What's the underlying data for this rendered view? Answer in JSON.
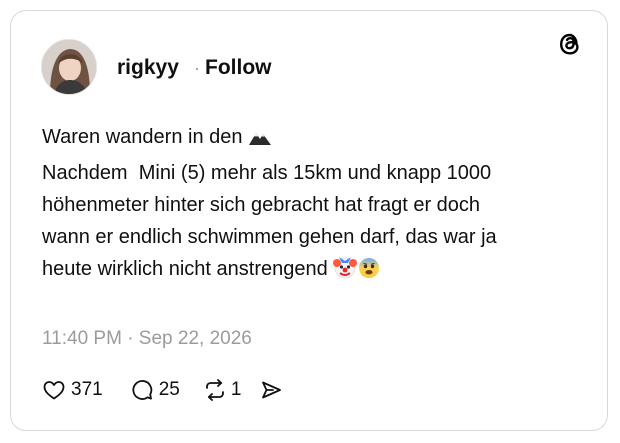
{
  "post": {
    "username": "rigkyy",
    "separator": "·",
    "follow_label": "Follow",
    "text_lines": [
      "Waren wandern in den",
      "",
      "Nachdem  Mini (5) mehr als 15km und knapp 1000",
      "höhenmeter hinter sich gebracht hat fragt er doch",
      "wann er endlich schwimmen gehen darf, das war ja",
      "heute wirklich nicht anstrengend"
    ],
    "emojis": [
      "mountain-emoji",
      "clown-face-emoji",
      "fearful-face-emoji"
    ],
    "timestamp": "11:40 PM · Sep 22, 2026"
  },
  "actions": {
    "likes": "371",
    "replies": "25",
    "reposts": "1"
  },
  "icons": {
    "logo": "threads-logo-icon",
    "like": "heart-icon",
    "reply": "comment-bubble-icon",
    "repost": "repost-icon",
    "share": "send-icon"
  },
  "colors": {
    "text": "#101010",
    "muted": "#9b9b9b",
    "border": "#d9d9d9"
  }
}
